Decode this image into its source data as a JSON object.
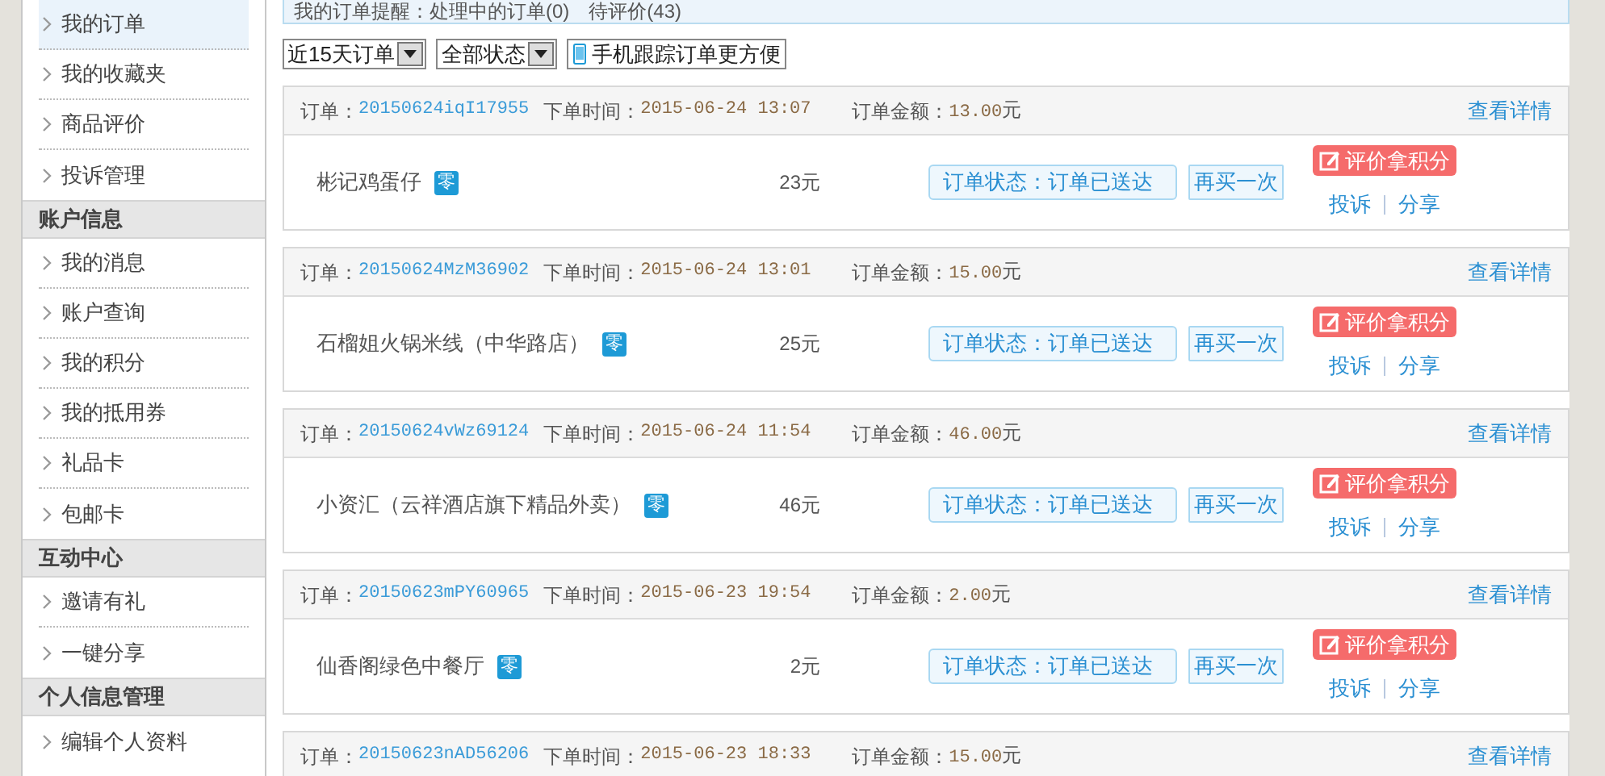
{
  "sidebar": [
    {
      "kind": "item",
      "label": "我的订单",
      "selected": true
    },
    {
      "kind": "item",
      "label": "我的收藏夹",
      "selected": false
    },
    {
      "kind": "item",
      "label": "商品评价",
      "selected": false
    },
    {
      "kind": "item",
      "label": "投诉管理",
      "selected": false
    },
    {
      "kind": "header",
      "label": "账户信息"
    },
    {
      "kind": "item",
      "label": "我的消息",
      "selected": false
    },
    {
      "kind": "item",
      "label": "账户查询",
      "selected": false
    },
    {
      "kind": "item",
      "label": "我的积分",
      "selected": false
    },
    {
      "kind": "item",
      "label": "我的抵用券",
      "selected": false
    },
    {
      "kind": "item",
      "label": "礼品卡",
      "selected": false
    },
    {
      "kind": "item",
      "label": "包邮卡",
      "selected": false
    },
    {
      "kind": "header",
      "label": "互动中心"
    },
    {
      "kind": "item",
      "label": "邀请有礼",
      "selected": false
    },
    {
      "kind": "item",
      "label": "一键分享",
      "selected": false
    },
    {
      "kind": "header",
      "label": "个人信息管理"
    },
    {
      "kind": "item",
      "label": "编辑个人资料",
      "selected": false
    }
  ],
  "notice": "我的订单提醒：处理中的订单(0)　待评价(43)",
  "filters": {
    "period": "近15天订单",
    "status": "全部状态",
    "mobile_link": "手机跟踪订单更方便"
  },
  "orders": [
    {
      "order_label": "订单：",
      "order_no": "20150624iqI17955",
      "time_label": "下单时间：",
      "time": "2015-06-24 13:07",
      "amount_label": "订单金额：",
      "amount": "13.00",
      "amount_unit": "元",
      "details": "查看详情",
      "shop": "彬记鸡蛋仔",
      "badge": "零",
      "price": "23元",
      "status": "订单状态：订单已送达",
      "rebuy": "再买一次",
      "review": "评价拿积分",
      "complain": "投诉",
      "share": "分享"
    },
    {
      "order_label": "订单：",
      "order_no": "20150624MzM36902",
      "time_label": "下单时间：",
      "time": "2015-06-24 13:01",
      "amount_label": "订单金额：",
      "amount": "15.00",
      "amount_unit": "元",
      "details": "查看详情",
      "shop": "石榴姐火锅米线（中华路店）",
      "badge": "零",
      "price": "25元",
      "status": "订单状态：订单已送达",
      "rebuy": "再买一次",
      "review": "评价拿积分",
      "complain": "投诉",
      "share": "分享"
    },
    {
      "order_label": "订单：",
      "order_no": "20150624vWz69124",
      "time_label": "下单时间：",
      "time": "2015-06-24 11:54",
      "amount_label": "订单金额：",
      "amount": "46.00",
      "amount_unit": "元",
      "details": "查看详情",
      "shop": "小资汇（云祥酒店旗下精品外卖）",
      "badge": "零",
      "price": "46元",
      "status": "订单状态：订单已送达",
      "rebuy": "再买一次",
      "review": "评价拿积分",
      "complain": "投诉",
      "share": "分享"
    },
    {
      "order_label": "订单：",
      "order_no": "20150623mPY60965",
      "time_label": "下单时间：",
      "time": "2015-06-23 19:54",
      "amount_label": "订单金额：",
      "amount": "2.00",
      "amount_unit": "元",
      "details": "查看详情",
      "shop": "仙香阁绿色中餐厅",
      "badge": "零",
      "price": "2元",
      "status": "订单状态：订单已送达",
      "rebuy": "再买一次",
      "review": "评价拿积分",
      "complain": "投诉",
      "share": "分享"
    },
    {
      "order_label": "订单：",
      "order_no": "20150623nAD56206",
      "time_label": "下单时间：",
      "time": "2015-06-23 18:33",
      "amount_label": "订单金额：",
      "amount": "15.00",
      "amount_unit": "元",
      "details": "查看详情"
    }
  ]
}
